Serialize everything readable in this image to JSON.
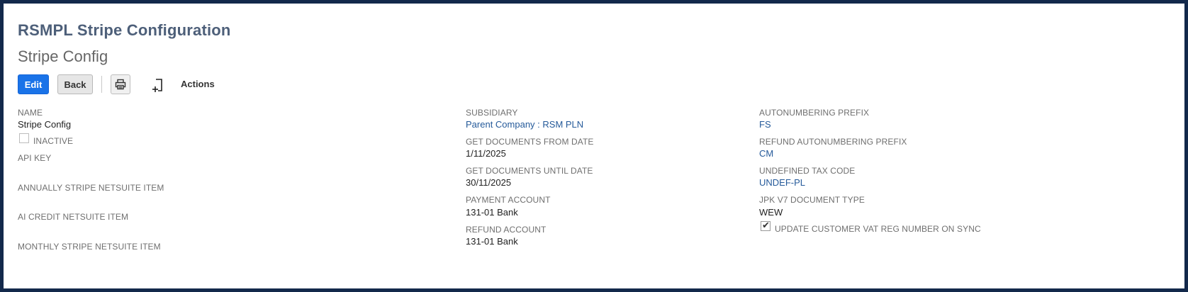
{
  "header": {
    "record_type": "RSMPL Stripe Configuration",
    "record_name": "Stripe Config"
  },
  "toolbar": {
    "edit_label": "Edit",
    "back_label": "Back",
    "actions_label": "Actions"
  },
  "fields": {
    "name_label": "NAME",
    "name_value": "Stripe Config",
    "inactive_label": "INACTIVE",
    "inactive_checked": false,
    "api_key_label": "API KEY",
    "annually_label": "ANNUALLY STRIPE NETSUITE ITEM",
    "ai_credit_label": "AI CREDIT NETSUITE ITEM",
    "monthly_label": "MONTHLY STRIPE NETSUITE ITEM",
    "subsidiary_label": "SUBSIDIARY",
    "subsidiary_value": "Parent Company : RSM PLN",
    "get_from_label": "GET DOCUMENTS FROM DATE",
    "get_from_value": "1/11/2025",
    "get_until_label": "GET DOCUMENTS UNTIL DATE",
    "get_until_value": "30/11/2025",
    "payment_account_label": "PAYMENT ACCOUNT",
    "payment_account_value": "131-01 Bank",
    "refund_account_label": "REFUND ACCOUNT",
    "refund_account_value": "131-01 Bank",
    "autonumbering_prefix_label": "AUTONUMBERING PREFIX",
    "autonumbering_prefix_value": "FS",
    "refund_autonumbering_label": "REFUND AUTONUMBERING PREFIX",
    "refund_autonumbering_value": "CM",
    "undefined_tax_label": "UNDEFINED TAX CODE",
    "undefined_tax_value": "UNDEF-PL",
    "jpk_label": "JPK V7 DOCUMENT TYPE",
    "jpk_value": "WEW",
    "update_vat_label": "UPDATE CUSTOMER VAT REG NUMBER ON SYNC",
    "update_vat_checked": true
  },
  "icons": {
    "print": "printer-icon",
    "add": "new-document-icon",
    "check": "checkmark-icon"
  },
  "colors": {
    "frame": "#13294b",
    "title": "#4d5f79",
    "edit_button": "#1a73e8",
    "link": "#255a9a"
  }
}
